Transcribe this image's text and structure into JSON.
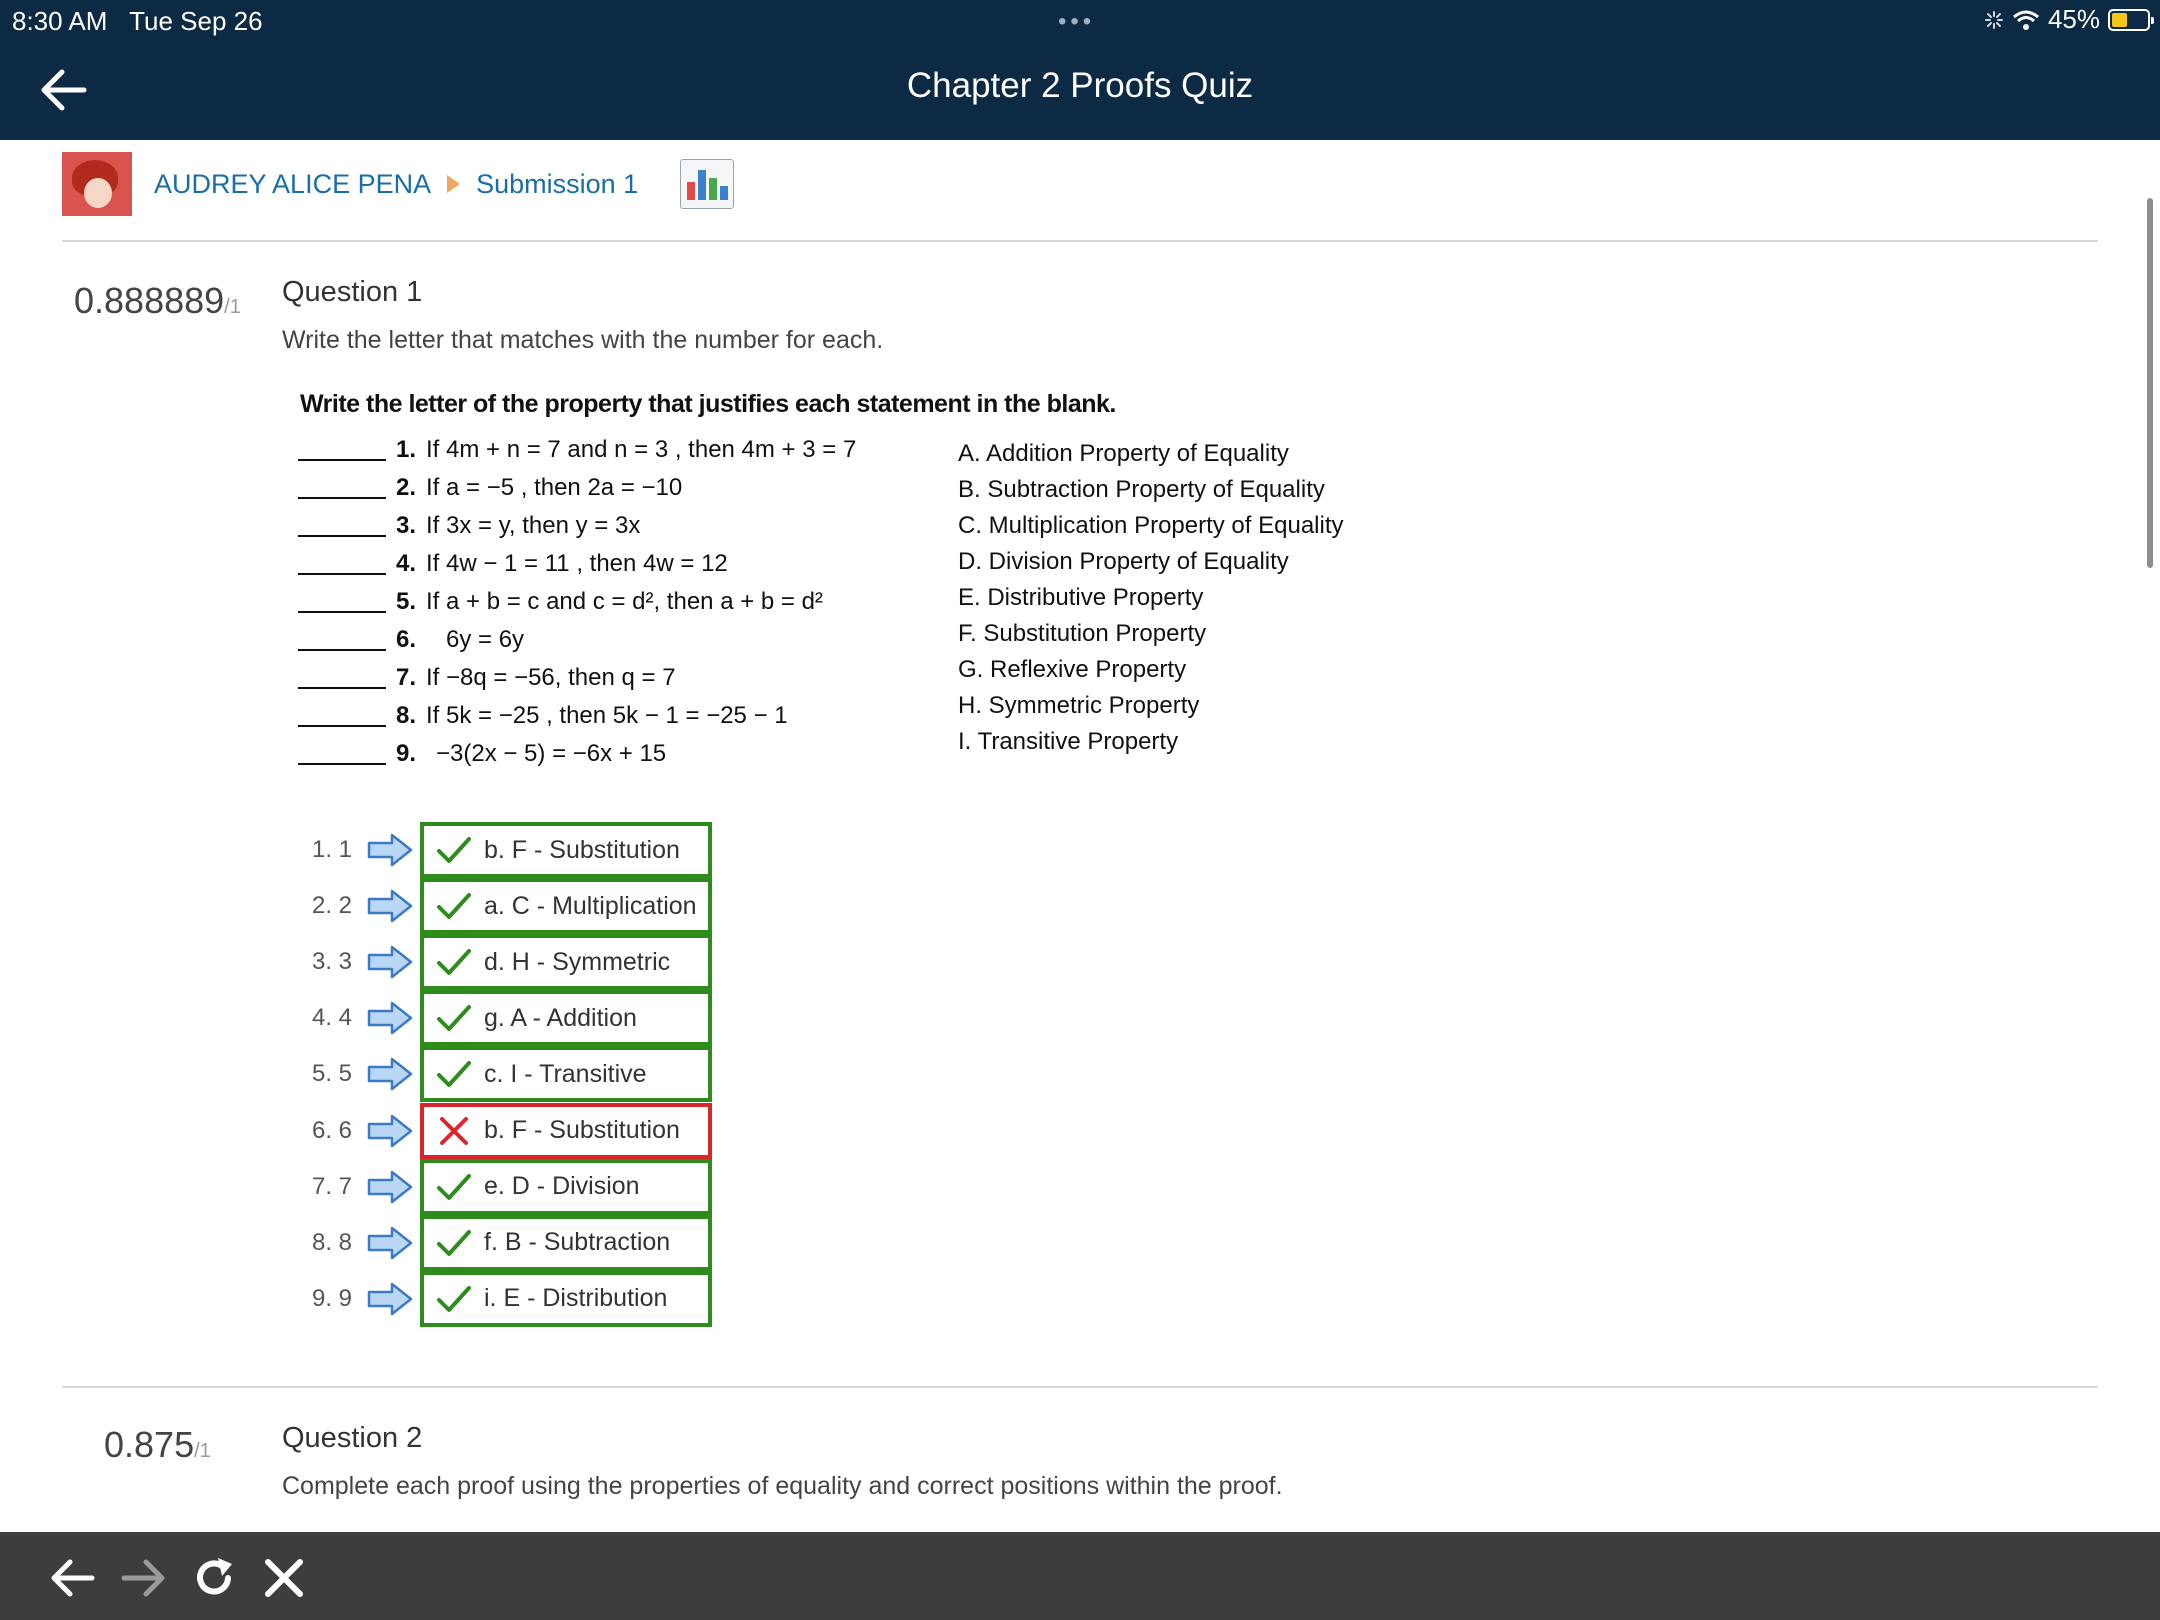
{
  "status": {
    "time": "8:30 AM",
    "date": "Tue Sep 26",
    "dots": "•••",
    "battery": "45%",
    "battery_level": 0.45
  },
  "header": {
    "title": "Chapter 2 Proofs Quiz",
    "back_icon": "arrow-left-icon"
  },
  "breadcrumb": {
    "user": "AUDREY ALICE PENA",
    "submission": "Submission 1",
    "stats_icon": "bar-chart-icon"
  },
  "question1": {
    "score": "0.888889",
    "out_of": "/1",
    "title": "Question 1",
    "prompt": "Write the letter that matches with the number for each.",
    "worksheet": {
      "heading": "Write the letter of the property that justifies each statement in the blank.",
      "statements": [
        {
          "num": "1.",
          "text": "If 4m + n = 7 and n = 3 , then 4m + 3 = 7"
        },
        {
          "num": "2.",
          "text": "If a = −5 , then 2a = −10"
        },
        {
          "num": "3.",
          "text": "If 3x = y, then y = 3x"
        },
        {
          "num": "4.",
          "text": "If 4w − 1 = 11 , then 4w = 12"
        },
        {
          "num": "5.",
          "text": "If a + b = c and c = d², then a + b = d²"
        },
        {
          "num": "6.",
          "text": "6y = 6y"
        },
        {
          "num": "7.",
          "text": "If −8q = −56, then q = 7"
        },
        {
          "num": "8.",
          "text": "If 5k = −25 , then 5k − 1 = −25 − 1"
        },
        {
          "num": "9.",
          "text": "−3(2x − 5) = −6x + 15"
        }
      ],
      "properties": [
        "A.  Addition Property of Equality",
        "B.  Subtraction Property of Equality",
        "C.  Multiplication Property of Equality",
        "D.  Division Property of Equality",
        "E.  Distributive Property",
        "F.  Substitution Property",
        "G.  Reflexive Property",
        "H.  Symmetric Property",
        "I.   Transitive Property"
      ]
    },
    "answers": [
      {
        "label": "1. 1",
        "value": "b. F - Substitution",
        "correct": true
      },
      {
        "label": "2. 2",
        "value": "a. C - Multiplication",
        "correct": true
      },
      {
        "label": "3. 3",
        "value": "d. H - Symmetric",
        "correct": true
      },
      {
        "label": "4. 4",
        "value": "g. A - Addition",
        "correct": true
      },
      {
        "label": "5. 5",
        "value": "c. I - Transitive",
        "correct": true
      },
      {
        "label": "6. 6",
        "value": "b. F - Substitution",
        "correct": false
      },
      {
        "label": "7. 7",
        "value": "e. D - Division",
        "correct": true
      },
      {
        "label": "8. 8",
        "value": "f. B - Subtraction",
        "correct": true
      },
      {
        "label": "9. 9",
        "value": "i. E - Distribution",
        "correct": true
      }
    ]
  },
  "question2": {
    "score": "0.875",
    "out_of": "/1",
    "title": "Question 2",
    "prompt": "Complete each proof using the properties of equality and correct positions within the proof."
  },
  "toolbar": {
    "back_icon": "arrow-left-icon",
    "forward_icon": "arrow-right-icon",
    "reload_icon": "reload-icon",
    "close_icon": "close-icon"
  },
  "colors": {
    "header_bg": "#0c2a44",
    "link": "#1a6ea8",
    "correct": "#2e8b1e",
    "wrong": "#d9262b",
    "toolbar_bg": "#3d3d3d"
  }
}
